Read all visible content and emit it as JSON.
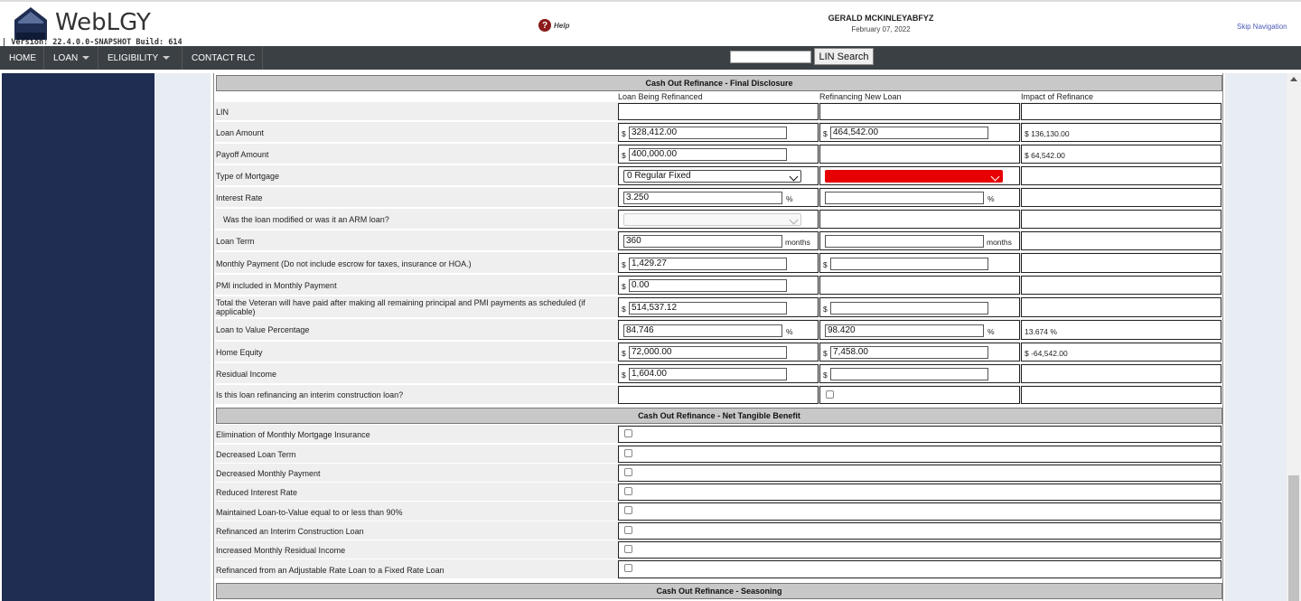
{
  "app": {
    "logo_text": "WebLGY",
    "version": "| Version: 22.4.0.0-SNAPSHOT Build: 614",
    "help_label": "Help",
    "user_name": "GERALD MCKINLEYABFYZ",
    "date": "February 07, 2022",
    "skip_nav": "Skip Navigation"
  },
  "nav": {
    "items": [
      "HOME",
      "LOAN",
      "ELIGIBILITY",
      "CONTACT RLC"
    ],
    "lin_search_label": "LIN Search",
    "lin_search_value": ""
  },
  "final_disclosure": {
    "title": "Cash Out Refinance - Final Disclosure",
    "columns": [
      "Loan Being Refinanced",
      "Refinancing New Loan",
      "Impact of Refinance"
    ],
    "rows": {
      "lin": "LIN",
      "loan_amount": {
        "label": "Loan Amount",
        "old": "328,412.00",
        "new": "464,542.00",
        "impact": "$ 136,130.00"
      },
      "payoff_amount": {
        "label": "Payoff Amount",
        "old": "400,000.00",
        "impact": "$ 64,542.00"
      },
      "mortgage_type": {
        "label": "Type of Mortgage",
        "old": "0 Regular Fixed",
        "new": ""
      },
      "interest_rate": {
        "label": "Interest Rate",
        "old": "3.250",
        "new": ""
      },
      "arm_modified": {
        "label": "Was the loan modified or was it an ARM loan?"
      },
      "loan_term": {
        "label": "Loan Term",
        "old": "360",
        "new": ""
      },
      "monthly_payment": {
        "label": "Monthly Payment (Do not include escrow for taxes, insurance or HOA.)",
        "old": "1,429.27",
        "new": ""
      },
      "pmi": {
        "label": "PMI included in Monthly Payment",
        "old": "0.00"
      },
      "total_paid": {
        "label": "Total the Veteran will have paid after making all remaining principal and PMI payments as scheduled (if applicable)",
        "old": "514,537.12",
        "new": ""
      },
      "ltv": {
        "label": "Loan to Value Percentage",
        "old": "84.746",
        "new": "98.420",
        "impact": "13.674 %"
      },
      "home_equity": {
        "label": "Home Equity",
        "old": "72,000.00",
        "new": "7,458.00",
        "impact": "$ -64,542.00"
      },
      "residual_income": {
        "label": "Residual Income",
        "old": "1,604.00",
        "new": ""
      },
      "interim_construction": {
        "label": "Is this loan refinancing an interim construction loan?"
      }
    },
    "units": {
      "dollar": "$",
      "percent": "%",
      "months": "months"
    }
  },
  "net_tangible": {
    "title": "Cash Out Refinance - Net Tangible Benefit",
    "items": [
      "Elimination of Monthly Mortgage Insurance",
      "Decreased Loan Term",
      "Decreased Monthly Payment",
      "Reduced Interest Rate",
      "Maintained Loan-to-Value equal to or less than 90%",
      "Refinanced an Interim Construction Loan",
      "Increased Monthly Residual Income",
      "Refinanced from an Adjustable Rate Loan to a Fixed Rate Loan"
    ]
  },
  "seasoning": {
    "title": "Cash Out Refinance - Seasoning"
  },
  "colors": {
    "sidebar": "#1f2d52",
    "nav": "#3b4045",
    "error": "#e60000"
  }
}
